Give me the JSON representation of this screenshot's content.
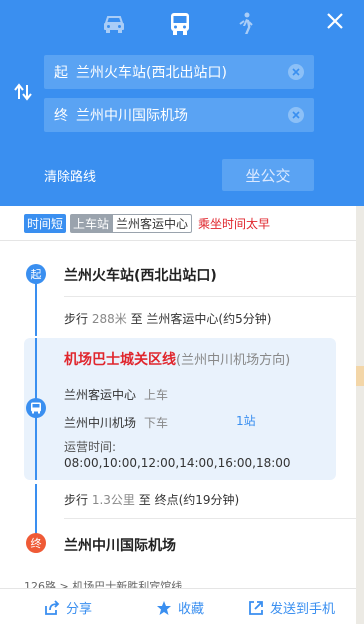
{
  "modes": {
    "car": "car-icon",
    "bus": "bus-icon",
    "walk": "walk-icon"
  },
  "route": {
    "start_tag": "起",
    "start_value": "兰州火车站(西北出站口)",
    "end_tag": "终",
    "end_value": "兰州中川国际机场",
    "clear_label": "清除路线",
    "bus_button": "坐公交"
  },
  "tags": {
    "fast": "时间短",
    "board_label": "上车站",
    "board_station": "兰州客运中心",
    "warning": "乘坐时间太早"
  },
  "timeline": {
    "start_badge": "起",
    "start_name": "兰州火车站(西北出站口)",
    "walk1_prefix": "步行",
    "walk1_dist": "288米",
    "walk1_suffix": "至 兰州客运中心(约5分钟)",
    "line_name": "机场巴士城关区线",
    "line_direction": "(兰州中川机场方向)",
    "board_station": "兰州客运中心",
    "board_action": "上车",
    "alight_station": "兰州中川机场",
    "alight_action": "下车",
    "stops": "1站",
    "op_label": "运营时间:",
    "op_times": "08:00,10:00,12:00,14:00,16:00,18:00",
    "walk2_prefix": "步行",
    "walk2_dist": "1.3公里",
    "walk2_suffix": "至 终点(约19分钟)",
    "end_badge": "终",
    "end_name": "兰州中川国际机场"
  },
  "peek_text": "126路 > 机场巴士新胜利宾馆线",
  "bottom": {
    "share": "分享",
    "fav": "收藏",
    "send": "发送到手机"
  },
  "colors": {
    "primary": "#3a8ff0",
    "accent_red": "#e0262d",
    "end_orange": "#ef5a36"
  }
}
